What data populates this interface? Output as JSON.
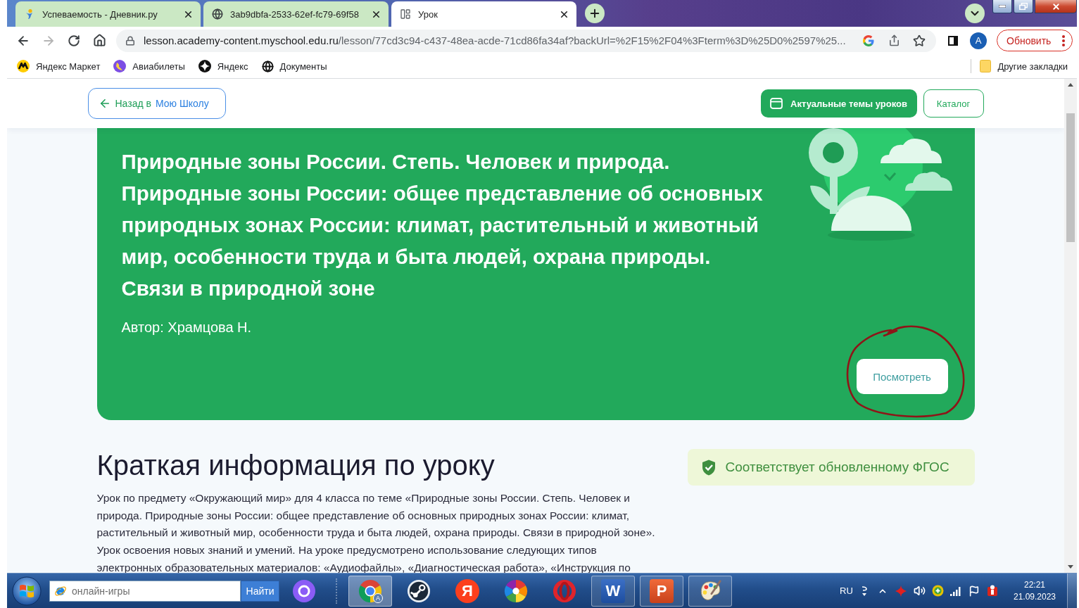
{
  "browser": {
    "tabs": [
      {
        "kind": "figure",
        "title": "Успеваемость - Дневник.ру",
        "selected": false
      },
      {
        "kind": "globe",
        "title": "3ab9dbfa-2533-62ef-fc79-69f58",
        "selected": false
      },
      {
        "kind": "layout",
        "title": "Урок",
        "selected": true
      }
    ],
    "navigation": {
      "back_disabled": false,
      "forward_disabled": true
    },
    "address": {
      "host": "lesson.academy-content.myschool.edu.ru",
      "path": "/lesson/77cd3c94-c437-48ea-acde-71cd86fa34af?backUrl=%2F15%2F04%3Fterm%3D%25D0%2597%25..."
    },
    "profile": "A",
    "update_button": "Обновить",
    "bookmarks": [
      {
        "kind": "market",
        "label": "Яндекс Маркет"
      },
      {
        "kind": "planet",
        "label": "Авиабилеты"
      },
      {
        "kind": "sparkle",
        "label": "Яндекс"
      },
      {
        "kind": "globe",
        "label": "Документы"
      }
    ],
    "other_bookmarks": "Другие закладки"
  },
  "page": {
    "header": {
      "back_button": {
        "prefix": "Назад в",
        "label": "Мою Школу"
      },
      "topics_button": "Актуальные темы уроков",
      "catalog_button": "Каталог"
    },
    "lesson": {
      "title": "Природные зоны России. Степь. Человек и природа. Природные зоны России: общее представление об основных природных зонах России: климат, растительный и животный мир, особенности труда и быта людей, охрана природы. Связи в природной зоне",
      "author": "Автор: Храмцова Н.",
      "view_button": "Посмотреть"
    },
    "summary": {
      "heading": "Краткая информация по уроку",
      "badge": "Соответствует обновленному ФГОС",
      "text": "Урок по предмету «Окружающий мир» для 4 класса по теме «Природные зоны России. Степь. Человек и природа. Природные зоны России: общее представление об основных природных зонах России: климат, растительный и животный мир, особенности труда и быта людей, охрана природы. Связи в природной зоне». Урок освоения новых знаний и умений. На уроке предусмотрено использование следующих типов электронных образовательных материалов: «Аудиофайлы», «Диагностическая работа», «Инструкция по"
    }
  },
  "taskbar": {
    "search": {
      "placeholder": "онлайн-игры",
      "button": "Найти"
    },
    "apps": [
      {
        "kind": "browser",
        "badge": "A",
        "running": true,
        "selected": true
      },
      {
        "kind": "disc",
        "running": false,
        "selected": false
      },
      {
        "kind": "letter",
        "glyph": "Я",
        "running": false,
        "selected": false
      },
      {
        "kind": "pinwheel",
        "running": false,
        "selected": false
      },
      {
        "kind": "ring",
        "running": false,
        "selected": false
      },
      {
        "kind": "document",
        "glyph": "W",
        "running": true,
        "selected": false
      },
      {
        "kind": "slides",
        "glyph": "P",
        "running": true,
        "selected": false
      },
      {
        "kind": "palette",
        "running": true,
        "selected": false
      }
    ],
    "language": "RU",
    "time": "22:21",
    "date": "21.09.2023"
  }
}
